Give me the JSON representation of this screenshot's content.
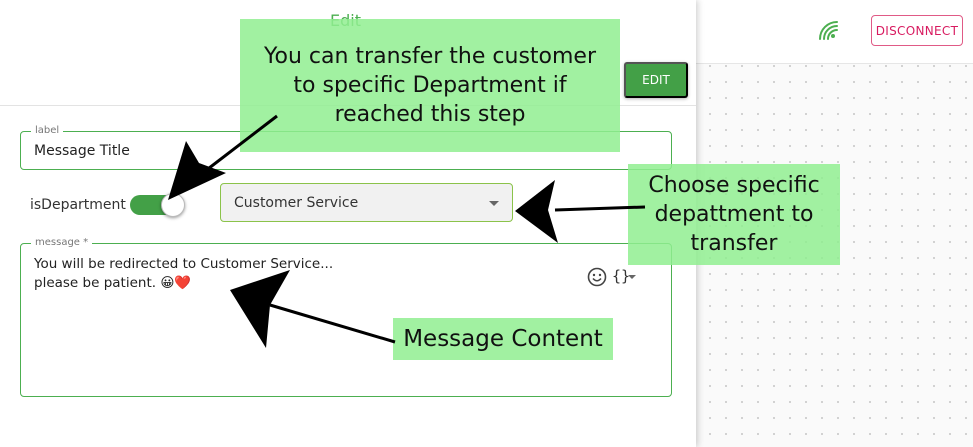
{
  "header": {
    "title": "Edit",
    "edit_button": "EDIT",
    "disconnect_button": "DISCONNECT"
  },
  "form": {
    "label_field": {
      "legend": "label",
      "value": "Message Title"
    },
    "department_toggle": {
      "label": "isDepartment",
      "checked": true
    },
    "department_select": {
      "selected": "Customer Service"
    },
    "message_field": {
      "legend": "message *",
      "line1": "You will be redirected to Customer Service...",
      "line2": "please be patient. 😀❤️"
    }
  },
  "annotations": {
    "callout_department": "You can transfer the customer to specific Department if reached this step",
    "callout_select": "Choose specific depattment to transfer",
    "callout_message": "Message Content"
  },
  "colors": {
    "accent_green": "#43a047",
    "disconnect_pink": "#d81b60",
    "callout_bg": "#90ee90"
  },
  "icons": {
    "connection": "wifi-icon",
    "emoji": "emoji-icon",
    "variables": "braces-icon"
  }
}
